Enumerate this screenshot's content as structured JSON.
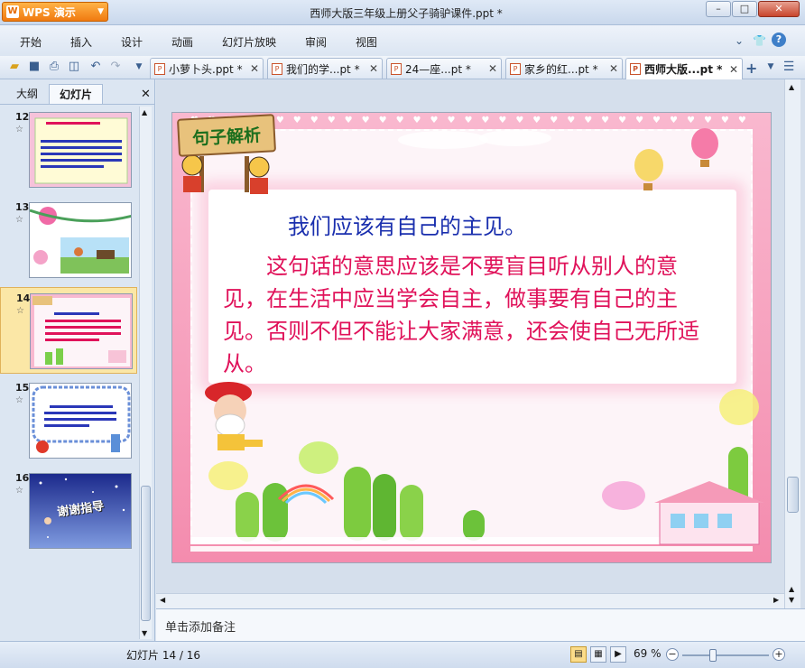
{
  "app": {
    "button_label": "WPS 演示",
    "window_title": "西师大版三年级上册父子骑驴课件.ppt *"
  },
  "window_controls": {
    "minimize": "–",
    "maximize": "□",
    "close": "✕"
  },
  "menu": {
    "items": [
      "开始",
      "插入",
      "设计",
      "动画",
      "幻灯片放映",
      "审阅",
      "视图"
    ],
    "right_chevron": "⌄",
    "help": "?"
  },
  "doc_tabs": [
    {
      "label": "小萝卜头.ppt *",
      "close": "✕"
    },
    {
      "label": "我们的学...pt *",
      "close": "✕"
    },
    {
      "label": "24—座...pt *",
      "close": "✕"
    },
    {
      "label": "家乡的红...pt *",
      "close": "✕"
    },
    {
      "label": "西师大版...pt *",
      "close": "✕",
      "active": true
    }
  ],
  "panel": {
    "tabs": [
      "大纲",
      "幻灯片"
    ],
    "active_tab": "幻灯片",
    "close": "✕"
  },
  "slides": [
    {
      "number": "12"
    },
    {
      "number": "13"
    },
    {
      "number": "14",
      "selected": true
    },
    {
      "number": "15"
    },
    {
      "number": "16"
    }
  ],
  "current_slide": {
    "sign": "句子解析",
    "line1": "我们应该有自己的主见。",
    "paragraph": "　　这句话的意思应该是不要盲目听从别人的意见，在生活中应当学会自主，做事要有自己的主见。否则不但不能让大家满意，还会使自己无所适从。"
  },
  "thumb16_text": "谢谢指导",
  "notes": {
    "placeholder": "单击添加备注"
  },
  "status": {
    "slide_counter": "幻灯片 14 / 16",
    "zoom": "69 %"
  },
  "colors": {
    "accent": "#f07a10",
    "slide_blue_text": "#1a2fae",
    "slide_red_text": "#e0125a",
    "selection": "#fbe7a6"
  }
}
